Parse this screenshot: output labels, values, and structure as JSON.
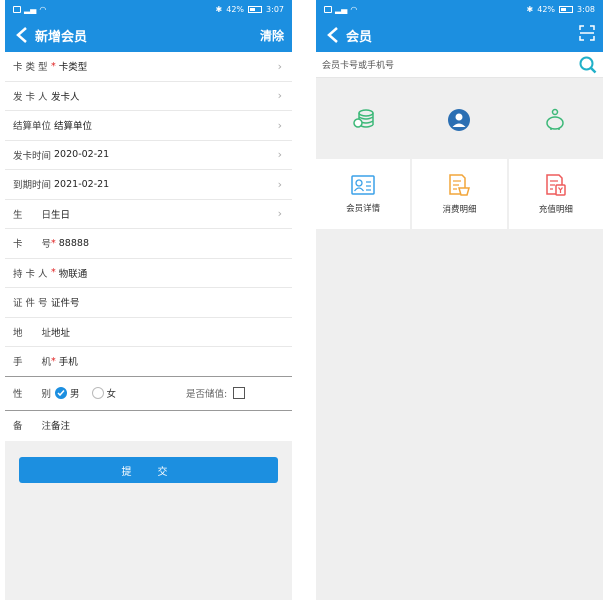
{
  "left": {
    "status": {
      "time": "3:07",
      "battery": "42%"
    },
    "title": "新增会员",
    "action": "清除",
    "rows": [
      {
        "label": "卡 类 型",
        "required": "*",
        "value": "卡类型"
      },
      {
        "label": "发 卡 人",
        "required": "",
        "value": "发卡人"
      },
      {
        "label": "结算单位",
        "required": "",
        "value": "结算单位"
      },
      {
        "label": "发卡时间",
        "required": "",
        "value": "2020-02-21"
      },
      {
        "label": "到期时间",
        "required": "",
        "value": "2021-02-21"
      },
      {
        "label": "生　　日",
        "required": "",
        "value": "生日"
      },
      {
        "label": "卡　　号",
        "required": "*",
        "value": "88888"
      },
      {
        "label": "持 卡 人",
        "required": "*",
        "value": "物联通"
      },
      {
        "label": "证 件 号",
        "required": "",
        "value": "证件号"
      },
      {
        "label": "地　　址",
        "required": "",
        "value": "地址"
      },
      {
        "label": "手　　机",
        "required": "*",
        "value": "手机"
      }
    ],
    "gender": {
      "label": "性　　别",
      "male": "男",
      "female": "女",
      "stored_label": "是否储值:"
    },
    "remark": {
      "label": "备　　注",
      "value": "备注"
    },
    "submit": "提　交"
  },
  "right": {
    "status": {
      "time": "3:08",
      "battery": "42%"
    },
    "title": "会员",
    "search_placeholder": "会员卡号或手机号",
    "grid": [
      {
        "label": "会员详情",
        "icon": "member-card-icon",
        "color": "#3aa0e8"
      },
      {
        "label": "消费明细",
        "icon": "consumption-icon",
        "color": "#f2a53a"
      },
      {
        "label": "充值明细",
        "icon": "recharge-icon",
        "color": "#ee5b5b"
      }
    ],
    "quick_icons": [
      "coins-icon",
      "user-icon",
      "piggy-bank-icon"
    ]
  },
  "colors": {
    "primary": "#1c8fe0",
    "required": "#e02020"
  }
}
